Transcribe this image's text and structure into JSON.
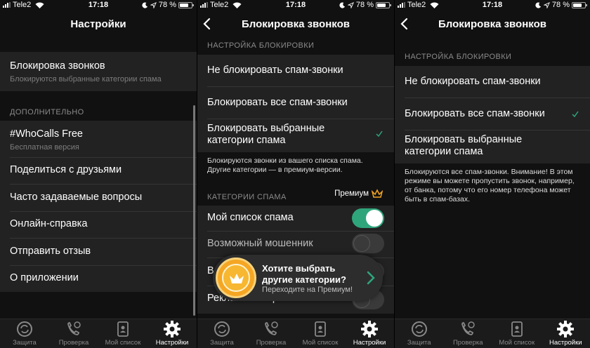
{
  "status": {
    "carrier": "Tele2",
    "time": "17:18",
    "battery": "78 %"
  },
  "colors": {
    "accent": "#2fa57c",
    "premium": "#f5a623",
    "check": "#2fa57c"
  },
  "screen1": {
    "title": "Настройки",
    "blocking": {
      "label": "Блокировка звонков",
      "sub": "Блокируются выбранные категории спама"
    },
    "extra_header": "ДОПОЛНИТЕЛЬНО",
    "app": {
      "label": "#WhoCalls Free",
      "sub": "Бесплатная версия"
    },
    "items": [
      "Поделиться с друзьями",
      "Часто задаваемые вопросы",
      "Онлайн-справка",
      "Отправить отзыв",
      "О приложении"
    ]
  },
  "screen2": {
    "title": "Блокировка звонков",
    "section_header": "НАСТРОЙКА БЛОКИРОВКИ",
    "options": [
      "Не блокировать спам-звонки",
      "Блокировать все спам-звонки",
      "Блокировать выбранные категории спама"
    ],
    "selected": 2,
    "footnote": "Блокируются звонки из вашего списка спама. Другие категории — в премиум-версии.",
    "categories_header": "КАТЕГОРИИ СПАМА",
    "premium_label": "Премиум",
    "categories": [
      {
        "label": "Мой список спама",
        "on": true
      },
      {
        "label": "Возможный мошенник",
        "on": false
      },
      {
        "label": "В",
        "on": false
      },
      {
        "label": "Реклама интернета и связи",
        "on": false
      }
    ],
    "popup": {
      "title": "Хотите выбрать другие категории?",
      "sub": "Переходите на Премиум!"
    }
  },
  "screen3": {
    "title": "Блокировка звонков",
    "section_header": "НАСТРОЙКА БЛОКИРОВКИ",
    "options": [
      "Не блокировать спам-звонки",
      "Блокировать все спам-звонки",
      "Блокировать выбранные категории спама"
    ],
    "selected": 1,
    "footnote": "Блокируются все спам-звонки. Внимание! В этом режиме вы можете пропустить звонок, например, от банка, потому что его номер телефона может быть в спам-базах."
  },
  "tabs": [
    {
      "label": "Защита",
      "icon": "shield-refresh-icon"
    },
    {
      "label": "Проверка",
      "icon": "phone-check-icon"
    },
    {
      "label": "Мой список",
      "icon": "contact-list-icon"
    },
    {
      "label": "Настройки",
      "icon": "gear-icon"
    }
  ],
  "active_tab": 3
}
